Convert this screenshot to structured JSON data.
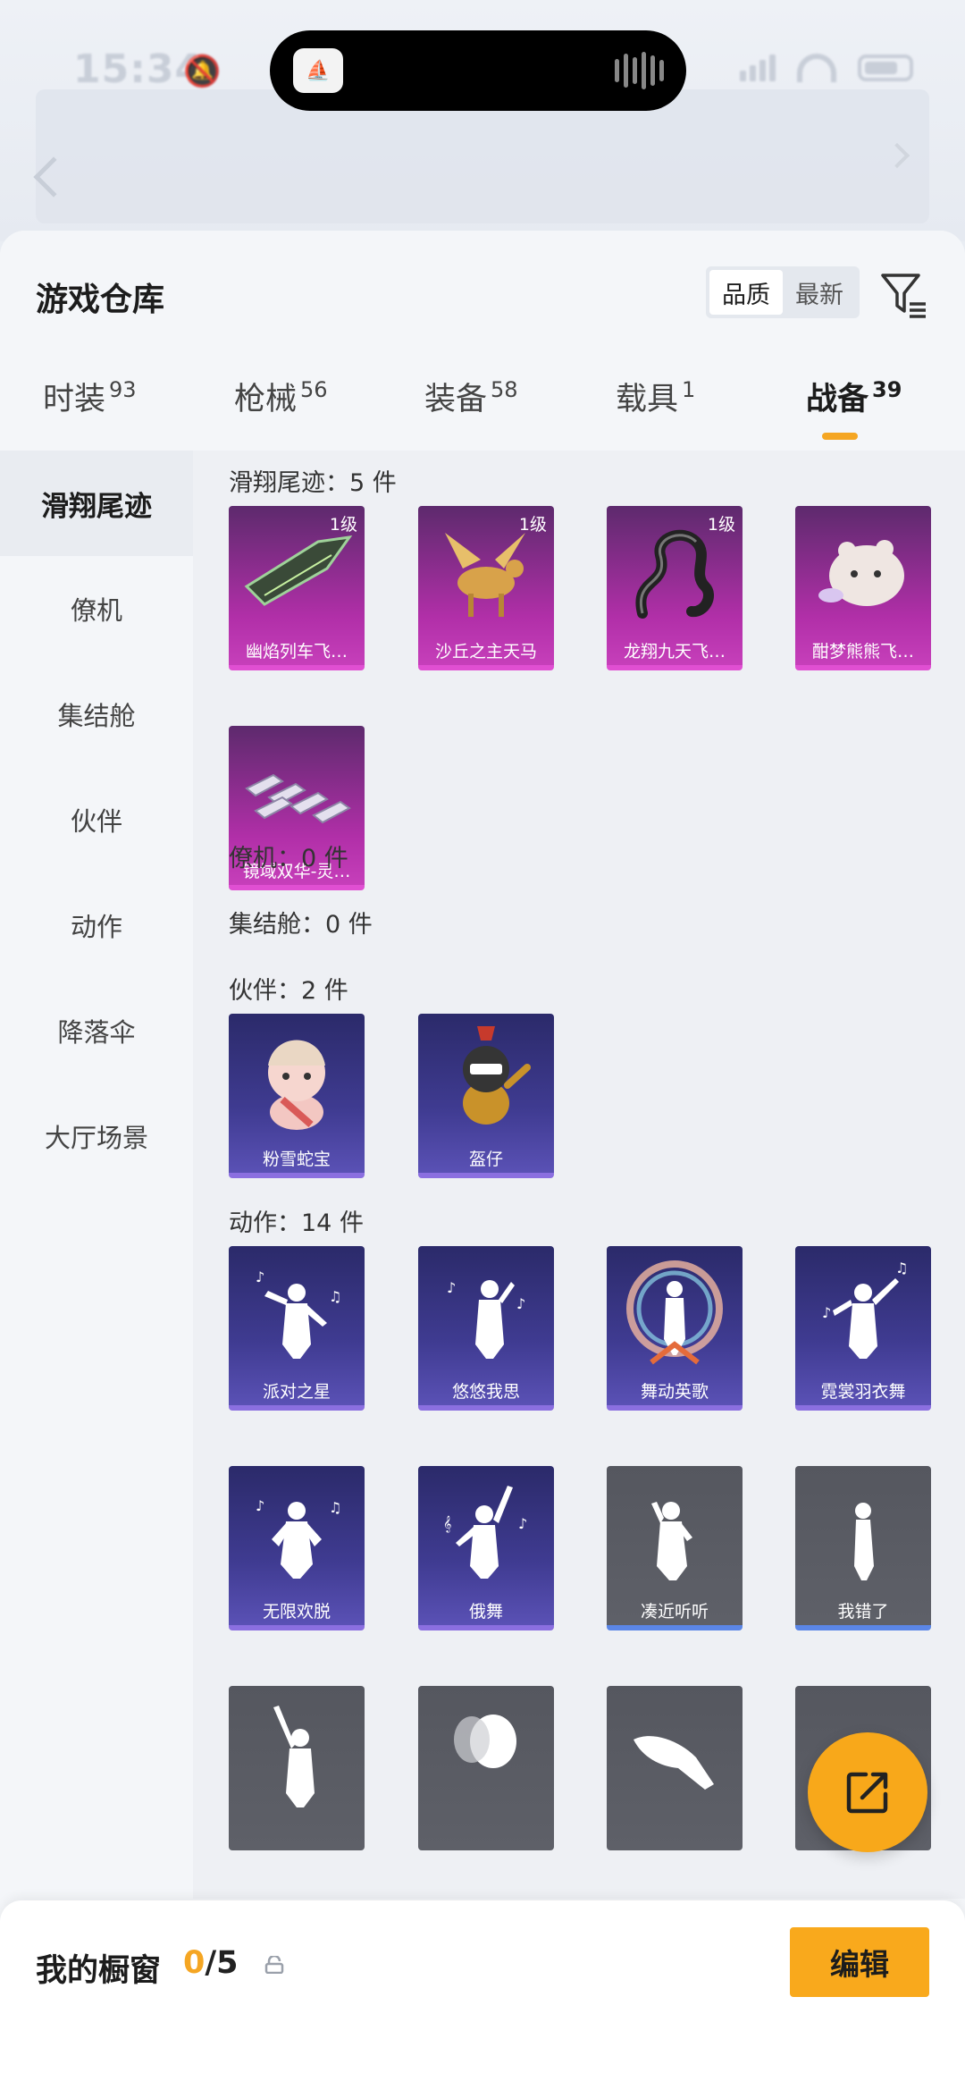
{
  "status_bar": {
    "time": "15:34"
  },
  "sheet": {
    "title": "游戏仓库",
    "sort": {
      "options": [
        "品质",
        "最新"
      ],
      "selected": "品质"
    }
  },
  "tabs": [
    {
      "label": "时装",
      "count": "93"
    },
    {
      "label": "枪械",
      "count": "56"
    },
    {
      "label": "装备",
      "count": "58"
    },
    {
      "label": "载具",
      "count": "1"
    },
    {
      "label": "战备",
      "count": "39"
    }
  ],
  "active_tab": "战备",
  "side_nav": [
    "滑翔尾迹",
    "僚机",
    "集结舱",
    "伙伴",
    "动作",
    "降落伞",
    "大厅场景"
  ],
  "sections": {
    "glide": {
      "label": "滑翔尾迹：5 件",
      "items": [
        {
          "name": "幽焰列车飞…",
          "level": "1级"
        },
        {
          "name": "沙丘之主天马",
          "level": "1级"
        },
        {
          "name": "龙翔九天飞…",
          "level": "1级"
        },
        {
          "name": "酣梦熊熊飞…",
          "level": ""
        },
        {
          "name": "镜域双华-灵…",
          "level": ""
        }
      ]
    },
    "wingman": {
      "label": "僚机：0 件"
    },
    "pod": {
      "label": "集结舱：0 件"
    },
    "companion": {
      "label": "伙伴：2 件",
      "items": [
        {
          "name": "粉雪蛇宝"
        },
        {
          "name": "盔仔"
        }
      ]
    },
    "emote": {
      "label": "动作：14 件",
      "items": [
        {
          "name": "派对之星"
        },
        {
          "name": "悠悠我思"
        },
        {
          "name": "舞动英歌"
        },
        {
          "name": "霓裳羽衣舞"
        },
        {
          "name": "无限欢脱"
        },
        {
          "name": "俄舞"
        },
        {
          "name": "凑近听听"
        },
        {
          "name": "我错了"
        },
        {
          "name": ""
        },
        {
          "name": ""
        },
        {
          "name": ""
        },
        {
          "name": ""
        }
      ]
    }
  },
  "bottom_bar": {
    "label": "我的橱窗",
    "count_current": "0",
    "count_total": "/5",
    "edit_label": "编辑"
  },
  "colors": {
    "accent": "#f5a623",
    "pink_rarity": "#c63fba",
    "purple_rarity": "#5a51b5",
    "gray_rarity": "#5e6068"
  }
}
